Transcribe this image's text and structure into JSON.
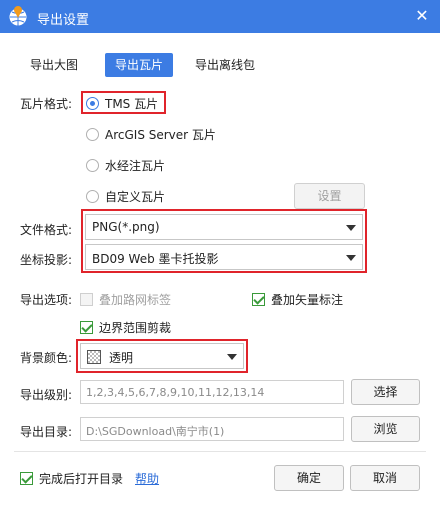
{
  "window": {
    "title": "导出设置",
    "close_glyph": "✕"
  },
  "tabs": [
    {
      "label": "导出大图",
      "active": false
    },
    {
      "label": "导出瓦片",
      "active": true
    },
    {
      "label": "导出离线包",
      "active": false
    }
  ],
  "tile_format": {
    "label": "瓦片格式:",
    "options": [
      {
        "label": "TMS 瓦片",
        "selected": true
      },
      {
        "label": "ArcGIS Server 瓦片",
        "selected": false
      },
      {
        "label": "水经注瓦片",
        "selected": false
      },
      {
        "label": "自定义瓦片",
        "selected": false
      }
    ],
    "settings_button": "设置"
  },
  "file_format": {
    "label": "文件格式:",
    "value": "PNG(*.png)"
  },
  "projection": {
    "label": "坐标投影:",
    "value": "BD09 Web 墨卡托投影"
  },
  "export_options": {
    "label": "导出选项:",
    "road_labels": {
      "label": "叠加路网标签",
      "checked": false,
      "enabled": false
    },
    "vector_labels": {
      "label": "叠加矢量标注",
      "checked": true,
      "enabled": true
    },
    "clip_boundary": {
      "label": "边界范围剪裁",
      "checked": true,
      "enabled": true
    }
  },
  "background": {
    "label": "背景颜色:",
    "value": "透明"
  },
  "levels": {
    "label": "导出级别:",
    "value": "1,2,3,4,5,6,7,8,9,10,11,12,13,14",
    "button": "选择"
  },
  "directory": {
    "label": "导出目录:",
    "value": "D:\\SGDownload\\南宁市(1)",
    "button": "浏览"
  },
  "footer": {
    "open_after": {
      "label": "完成后打开目录",
      "checked": true
    },
    "help_link": "帮助",
    "ok_button": "确定",
    "cancel_button": "取消"
  },
  "colors": {
    "accent": "#3c7ce3",
    "highlight_box": "#e0242b",
    "check": "#3a9a3a"
  },
  "icons": {
    "app": "globe-logo-icon",
    "close": "close-icon",
    "dropdown": "caret-down-icon",
    "swatch": "transparent-swatch-icon"
  }
}
